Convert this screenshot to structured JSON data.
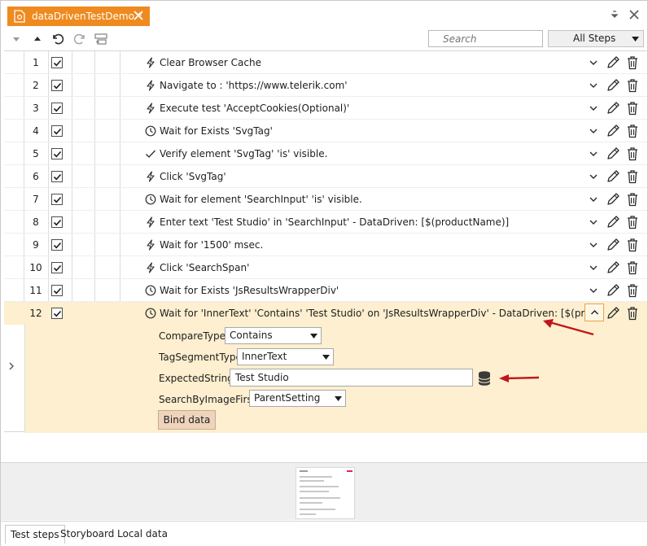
{
  "tab": {
    "title": "dataDrivenTestDemo",
    "modified_marker": "*"
  },
  "toolbar": {
    "search_placeholder": "Search",
    "filter_value": "All Steps"
  },
  "steps": [
    {
      "num": "1",
      "icon": "lightning-icon",
      "text": "Clear Browser Cache"
    },
    {
      "num": "2",
      "icon": "lightning-icon",
      "text": "Navigate to : 'https://www.telerik.com'"
    },
    {
      "num": "3",
      "icon": "lightning-icon",
      "text": "Execute test 'AcceptCookies(Optional)'"
    },
    {
      "num": "4",
      "icon": "clock-icon",
      "text": "Wait for Exists 'SvgTag'"
    },
    {
      "num": "5",
      "icon": "check-icon",
      "text": "Verify element 'SvgTag' 'is' visible."
    },
    {
      "num": "6",
      "icon": "lightning-icon",
      "text": "Click 'SvgTag'"
    },
    {
      "num": "7",
      "icon": "clock-icon",
      "text": "Wait for element 'SearchInput' 'is' visible."
    },
    {
      "num": "8",
      "icon": "lightning-icon",
      "text": "Enter text 'Test Studio' in 'SearchInput' - DataDriven: [$(productName)]"
    },
    {
      "num": "9",
      "icon": "lightning-icon",
      "text": "Wait for '1500' msec."
    },
    {
      "num": "10",
      "icon": "lightning-icon",
      "text": "Click 'SearchSpan'"
    },
    {
      "num": "11",
      "icon": "clock-icon",
      "text": "Wait for Exists 'JsResultsWrapperDiv'"
    },
    {
      "num": "12",
      "icon": "clock-icon",
      "text": "Wait for 'InnerText' 'Contains' 'Test Studio' on 'JsResultsWrapperDiv' - DataDriven: [$(productName)]"
    }
  ],
  "properties": {
    "compare_type_label": "CompareType:",
    "compare_type_value": "Contains",
    "tag_segment_label": "TagSegmentType:",
    "tag_segment_value": "InnerText",
    "expected_label": "ExpectedString:",
    "expected_value": "Test Studio",
    "search_image_label": "SearchByImageFirst:",
    "search_image_value": "ParentSetting",
    "bind_button": "Bind data"
  },
  "bottom_tabs": [
    "Test steps",
    "Storyboard",
    "Local data"
  ],
  "colors": {
    "accent": "#ef8a1f",
    "selected_row": "#fdefcf",
    "annotation_arrow": "#c0161d"
  }
}
